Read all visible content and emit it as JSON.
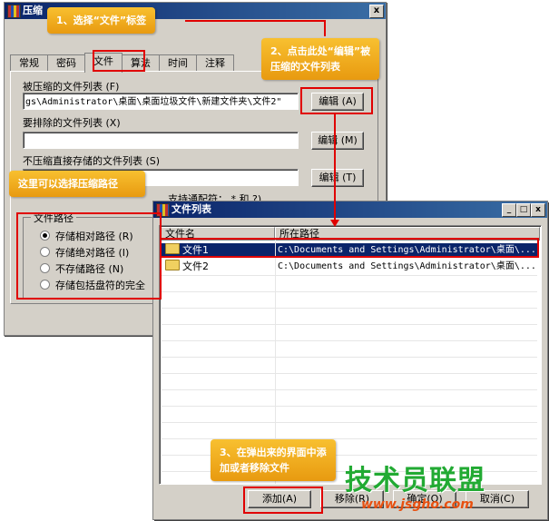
{
  "main_window": {
    "title": "压缩",
    "close": "x",
    "tabs": [
      "常规",
      "密码",
      "文件",
      "算法",
      "时间",
      "注释"
    ],
    "compressed_list_label": "被压缩的文件列表 (F)",
    "compressed_list_value": "gs\\Administrator\\桌面\\桌面垃圾文件\\新建文件夹\\文件2\"",
    "exclude_label": "要排除的文件列表 (X)",
    "exclude_value": "",
    "store_label": "不压缩直接存储的文件列表 (S)",
    "store_value": "",
    "wildcard_hint": "支持通配符： * 和 ?)",
    "edit_a": "编辑 (A)",
    "edit_m": "编辑 (M)",
    "edit_t": "编辑 (T)",
    "path_group_title": "文件路径",
    "radios": [
      {
        "label": "存储相对路径 (R)",
        "checked": true
      },
      {
        "label": "存储绝对路径 (I)",
        "checked": false
      },
      {
        "label": "不存储路径 (N)",
        "checked": false
      },
      {
        "label": "存储包括盘符的完全",
        "checked": false
      }
    ]
  },
  "list_window": {
    "title": "文件列表",
    "controls": [
      "_",
      "□",
      "x"
    ],
    "columns": [
      "文件名",
      "所在路径"
    ],
    "rows": [
      {
        "name": "文件1",
        "path": "C:\\Documents and Settings\\Administrator\\桌面\\...",
        "selected": true
      },
      {
        "name": "文件2",
        "path": "C:\\Documents and Settings\\Administrator\\桌面\\...",
        "selected": false
      }
    ],
    "buttons": [
      "添加(A)",
      "移除(R)",
      "确定(O)",
      "取消(C)"
    ]
  },
  "callouts": {
    "step1": "1、选择“文件”标签",
    "step2_line1": "2、点击此处“编辑”被",
    "step2_line2": "压缩的文件列表",
    "path_tip": "这里可以选择压缩路径",
    "step3_line1": "3、在弹出来的界面中添",
    "step3_line2": "加或者移除文件"
  },
  "watermark": {
    "brand": "技术员联盟",
    "url": "www.jsgho.com"
  },
  "colors": {
    "callout": "#f0a820",
    "highlight": "#e00000",
    "title_bar": "#0a246a",
    "watermark": "#22aa33"
  }
}
